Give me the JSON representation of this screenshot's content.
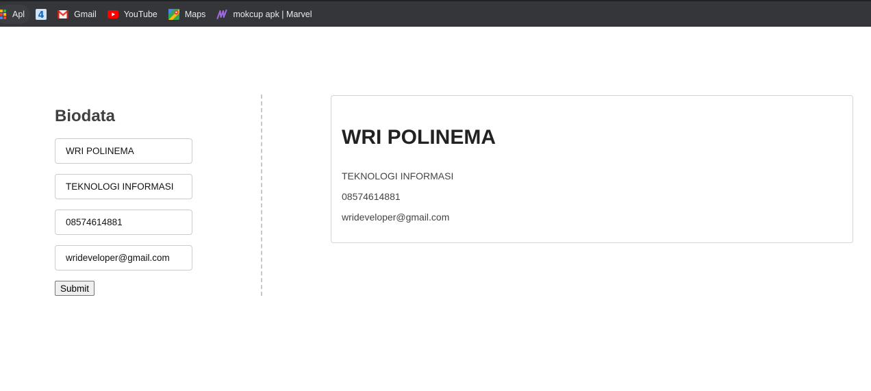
{
  "bookmarks": [
    {
      "label": "Apl",
      "icon": "apps-grid-icon"
    },
    {
      "label": "",
      "icon": "four-icon"
    },
    {
      "label": "Gmail",
      "icon": "gmail-icon"
    },
    {
      "label": "YouTube",
      "icon": "youtube-icon"
    },
    {
      "label": "Maps",
      "icon": "maps-icon"
    },
    {
      "label": "mokcup apk | Marvel",
      "icon": "marvel-icon"
    }
  ],
  "form": {
    "title": "Biodata",
    "fields": {
      "name": "WRI POLINEMA",
      "department": "TEKNOLOGI INFORMASI",
      "phone": "08574614881",
      "email": "wrideveloper@gmail.com"
    },
    "submit_label": "Submit"
  },
  "card": {
    "name": "WRI POLINEMA",
    "department": "TEKNOLOGI INFORMASI",
    "phone": "08574614881",
    "email": "wrideveloper@gmail.com"
  },
  "colors": {
    "bookmarks_bg": "#35363a",
    "title_text": "#404040",
    "youtube_red": "#ff0000",
    "marvel_purple": "#9c6ade"
  }
}
